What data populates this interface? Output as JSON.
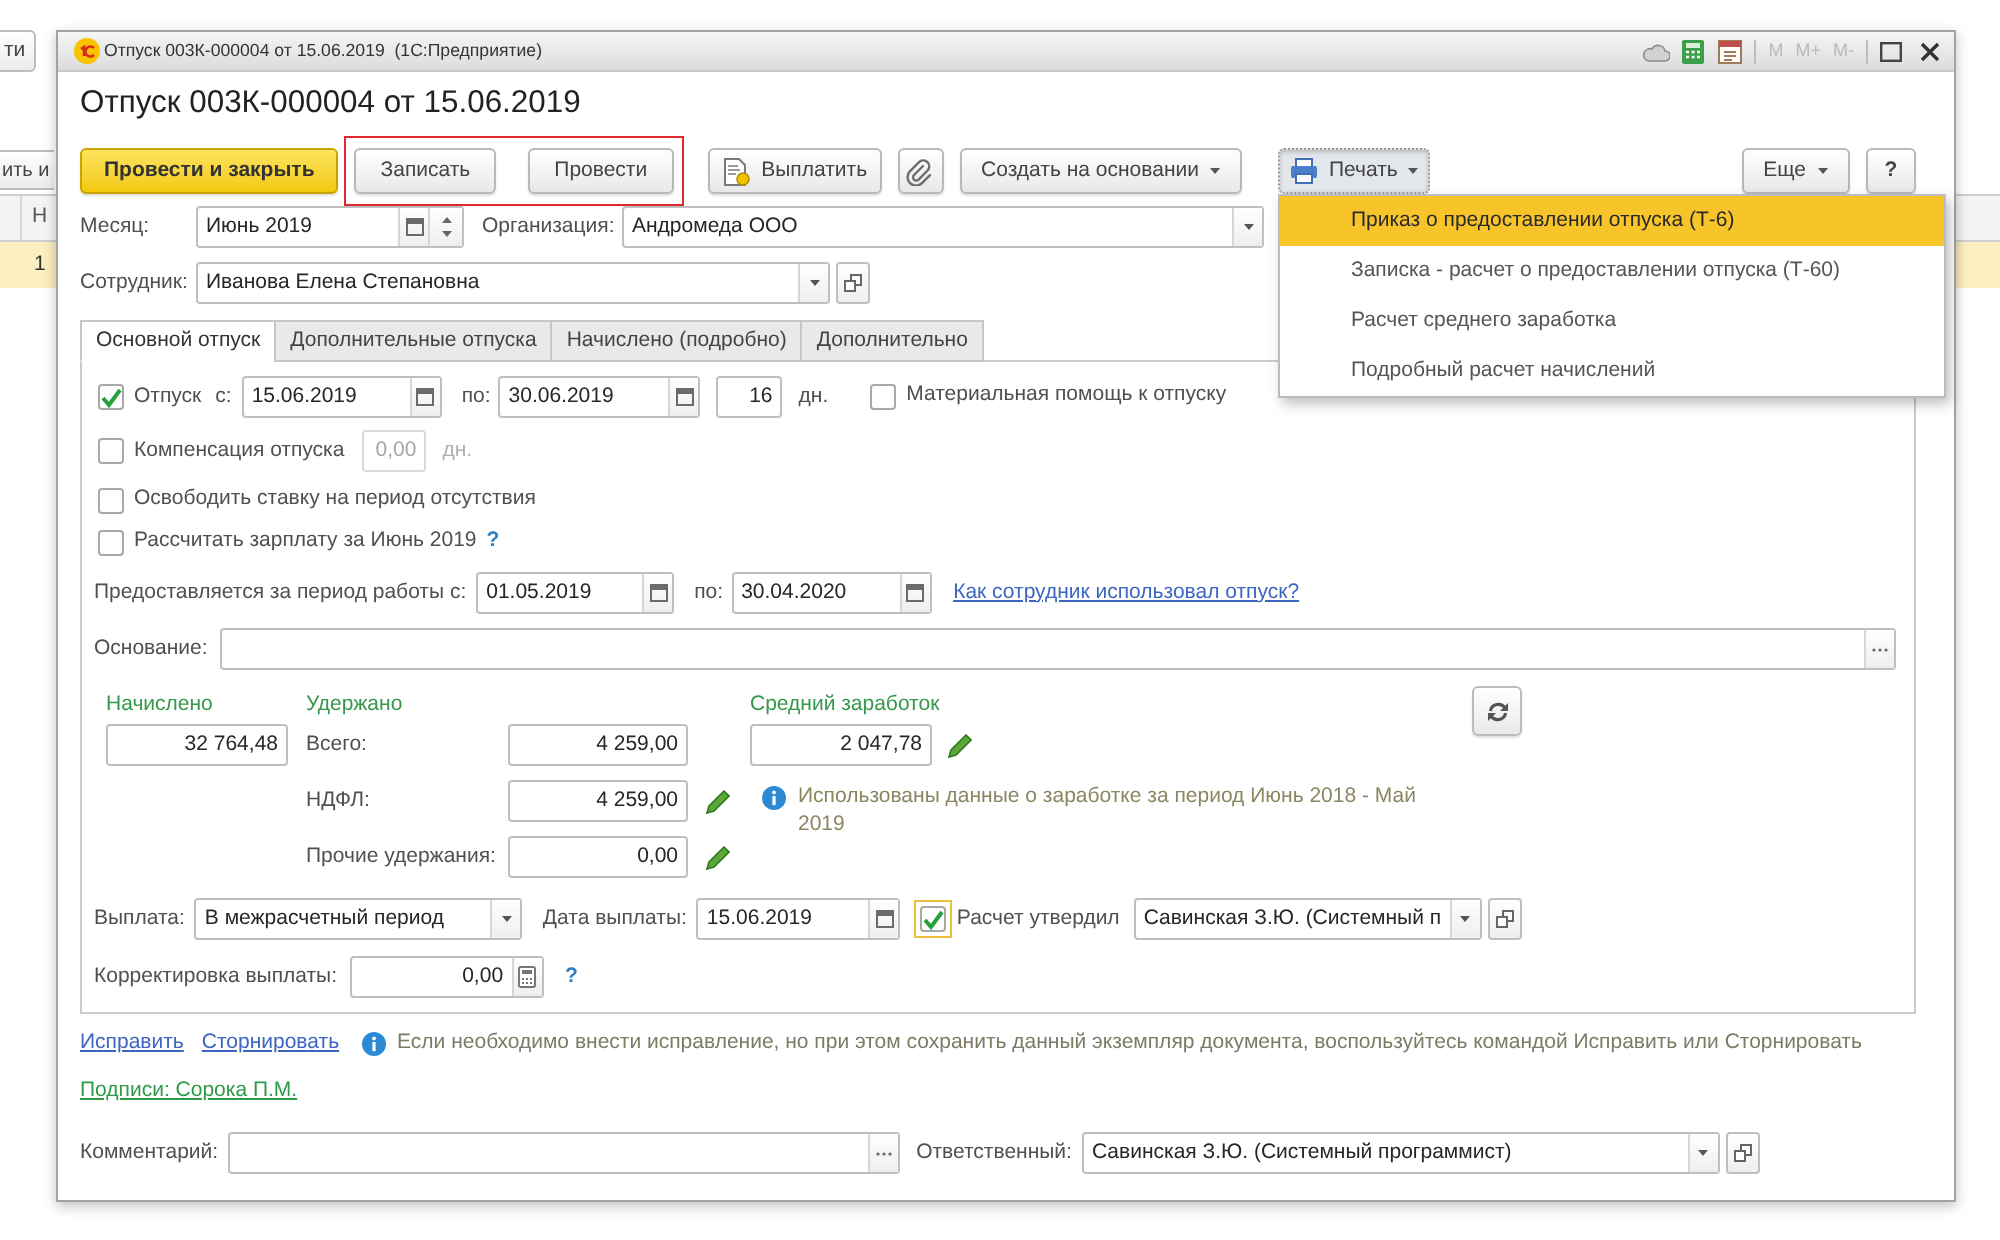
{
  "background_window": {
    "toolbar_buttons": [
      "ти",
      "ить и"
    ],
    "table": {
      "column_header": "Н",
      "rows": [
        {
          "cell": "1",
          "selected": true
        }
      ]
    }
  },
  "window": {
    "title": "Отпуск 003К-000004 от 15.06.2019  (1С:Предприятие)",
    "memory_buttons": [
      {
        "label": "M",
        "disabled": true
      },
      {
        "label": "M+",
        "disabled": true
      },
      {
        "label": "M-",
        "disabled": true
      }
    ]
  },
  "form": {
    "heading": "Отпуск 003К-000004 от 15.06.2019",
    "toolbar": {
      "left": [
        {
          "kind": "default",
          "label": "Провести и закрыть"
        },
        {
          "kind": "marked_group",
          "buttons": [
            {
              "label": "Записать"
            },
            {
              "label": "Провести"
            }
          ]
        },
        {
          "kind": "with_icon",
          "label": "Выплатить"
        },
        {
          "kind": "attach"
        },
        {
          "kind": "menu",
          "label": "Создать на основании",
          "expanded": false
        },
        {
          "kind": "print_menu",
          "label": "Печать",
          "expanded": true,
          "items": [
            {
              "label": "Приказ о предоставлении отпуска (Т-6)",
              "selected": true
            },
            {
              "label": "Записка - расчет о предоставлении отпуска (Т-60)",
              "selected": false
            },
            {
              "label": "Расчет среднего заработка",
              "selected": false
            },
            {
              "label": "Подробный расчет начислений",
              "selected": false
            }
          ]
        }
      ],
      "right": [
        {
          "kind": "menu",
          "label": "Еще",
          "expanded": false
        },
        {
          "kind": "help",
          "label": "?"
        }
      ]
    },
    "month": {
      "label": "Месяц:",
      "value": "Июнь 2019"
    },
    "organization": {
      "label": "Организация:",
      "value": "Андромеда ООО"
    },
    "employee": {
      "label": "Сотрудник:",
      "value": "Иванова Елена Степановна"
    },
    "tabs": [
      {
        "label": "Основной отпуск",
        "selected": true
      },
      {
        "label": "Дополнительные отпуска",
        "selected": false
      },
      {
        "label": "Начислено (подробно)",
        "selected": false
      },
      {
        "label": "Дополнительно",
        "selected": false
      }
    ],
    "main_tab": {
      "vacation": {
        "checked": true,
        "label": "Отпуск",
        "from_label": "с:",
        "from": "15.06.2019",
        "to_label": "по:",
        "to": "30.06.2019",
        "days": "16",
        "days_unit": "дн."
      },
      "material_aid": {
        "checked": false,
        "label": "Материальная помощь к отпуску"
      },
      "compensation": {
        "checked": false,
        "label": "Компенсация отпуска",
        "days": "0,00",
        "days_unit": "дн.",
        "disabled": true
      },
      "options": [
        {
          "checked": false,
          "label": "Освободить ставку на период отсутствия"
        },
        {
          "checked": false,
          "label": "Рассчитать зарплату за Июнь 2019",
          "help": "?"
        }
      ],
      "work_period": {
        "label": "Предоставляется за период работы с:",
        "from": "01.05.2019",
        "to_label": "по:",
        "to": "30.04.2020",
        "link": "Как сотрудник использовал отпуск?"
      },
      "basis": {
        "label": "Основание:"
      },
      "accrued": {
        "title": "Начислено",
        "value": "32 764,48"
      },
      "withheld": {
        "title": "Удержано",
        "rows": [
          {
            "label": "Всего:",
            "value": "4 259,00",
            "editable": false
          },
          {
            "label": "НДФЛ:",
            "value": "4 259,00",
            "editable": true
          },
          {
            "label": "Прочие удержания:",
            "value": "0,00",
            "editable": true
          }
        ]
      },
      "average_earnings": {
        "title": "Средний заработок",
        "value": "2 047,78",
        "editable": true,
        "note": "Использованы данные о заработке за период Июнь 2018 - Май 2019"
      },
      "payment": {
        "label": "Выплата:",
        "value": "В межрасчетный период",
        "date_label": "Дата выплаты:",
        "date": "15.06.2019"
      },
      "approval": {
        "checked": true,
        "focused": true,
        "label": "Расчет утвердил",
        "value": "Савинская З.Ю. (Системный п"
      },
      "correction": {
        "label": "Корректировка выплаты:",
        "value": "0,00",
        "help": "?"
      }
    },
    "footer": {
      "links": [
        "Исправить",
        "Сторнировать"
      ],
      "note": "Если необходимо внести исправление, но при этом сохранить данный экземпляр документа, воспользуйтесь командой Исправить или Сторнировать",
      "signatures": "Подписи: Сорока П.М.",
      "comment": {
        "label": "Комментарий:"
      },
      "responsible": {
        "label": "Ответственный:",
        "value": "Савинская З.Ю. (Системный программист)"
      }
    }
  }
}
